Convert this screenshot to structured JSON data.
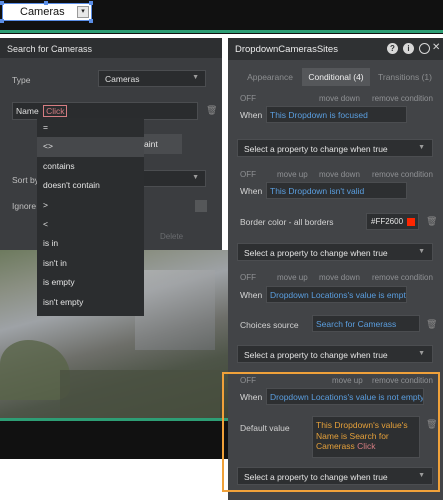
{
  "canvas": {
    "dropdown_value": "Cameras",
    "dropdown_arrow": "▾"
  },
  "search_panel": {
    "title": "Search for Camerass",
    "type_label": "Type",
    "type_value": "Cameras",
    "constraint_key": "Name",
    "constraint_value": "Click",
    "add_constraint_partial": "aint",
    "sort_label_partial": "Sort by",
    "ignore_label_partial": "Ignore",
    "delete_label": "Delete",
    "operators": [
      "=",
      "<>",
      "contains",
      "doesn't contain",
      ">",
      "<",
      "is in",
      "isn't in",
      "is empty",
      "isn't empty"
    ],
    "selected_operator_index": 1
  },
  "property_editor": {
    "title": "DropdownCamerasSites",
    "header_icons": [
      "help-icon",
      "info-icon",
      "comment-icon",
      "close-icon"
    ],
    "tabs": [
      {
        "label": "Appearance",
        "active": false
      },
      {
        "label": "Conditional (4)",
        "active": true
      },
      {
        "label": "Transitions (1)",
        "active": false
      }
    ],
    "off_label": "OFF",
    "move_up_label": "move up",
    "move_down_label": "move down",
    "remove_label": "remove condition",
    "when_label": "When",
    "select_property_placeholder": "Select a property to change when true",
    "conditions": [
      {
        "when": "This Dropdown is focused",
        "properties": []
      },
      {
        "when": "This Dropdown isn't valid",
        "properties": [
          {
            "label": "Border color - all borders",
            "value": "#FF2600",
            "swatch": "#ff2600"
          }
        ]
      },
      {
        "when": "Dropdown Locations's value is empty",
        "properties": [
          {
            "label": "Choices source",
            "value": "Search for Camerass"
          }
        ]
      },
      {
        "when": "Dropdown Locations's value is not empty",
        "properties": [
          {
            "label": "Default value",
            "value_lines": [
              "This Dropdown's value's",
              "Name is Search for",
              "Camerass"
            ],
            "value_suffix": "Click"
          }
        ]
      }
    ]
  },
  "colors": {
    "accent_highlight": "#f0a13a",
    "link_blue": "#5b9fe0",
    "expression_orange": "#e5a03a",
    "click_pink": "#d67d82",
    "green_line": "#2e9e75"
  }
}
